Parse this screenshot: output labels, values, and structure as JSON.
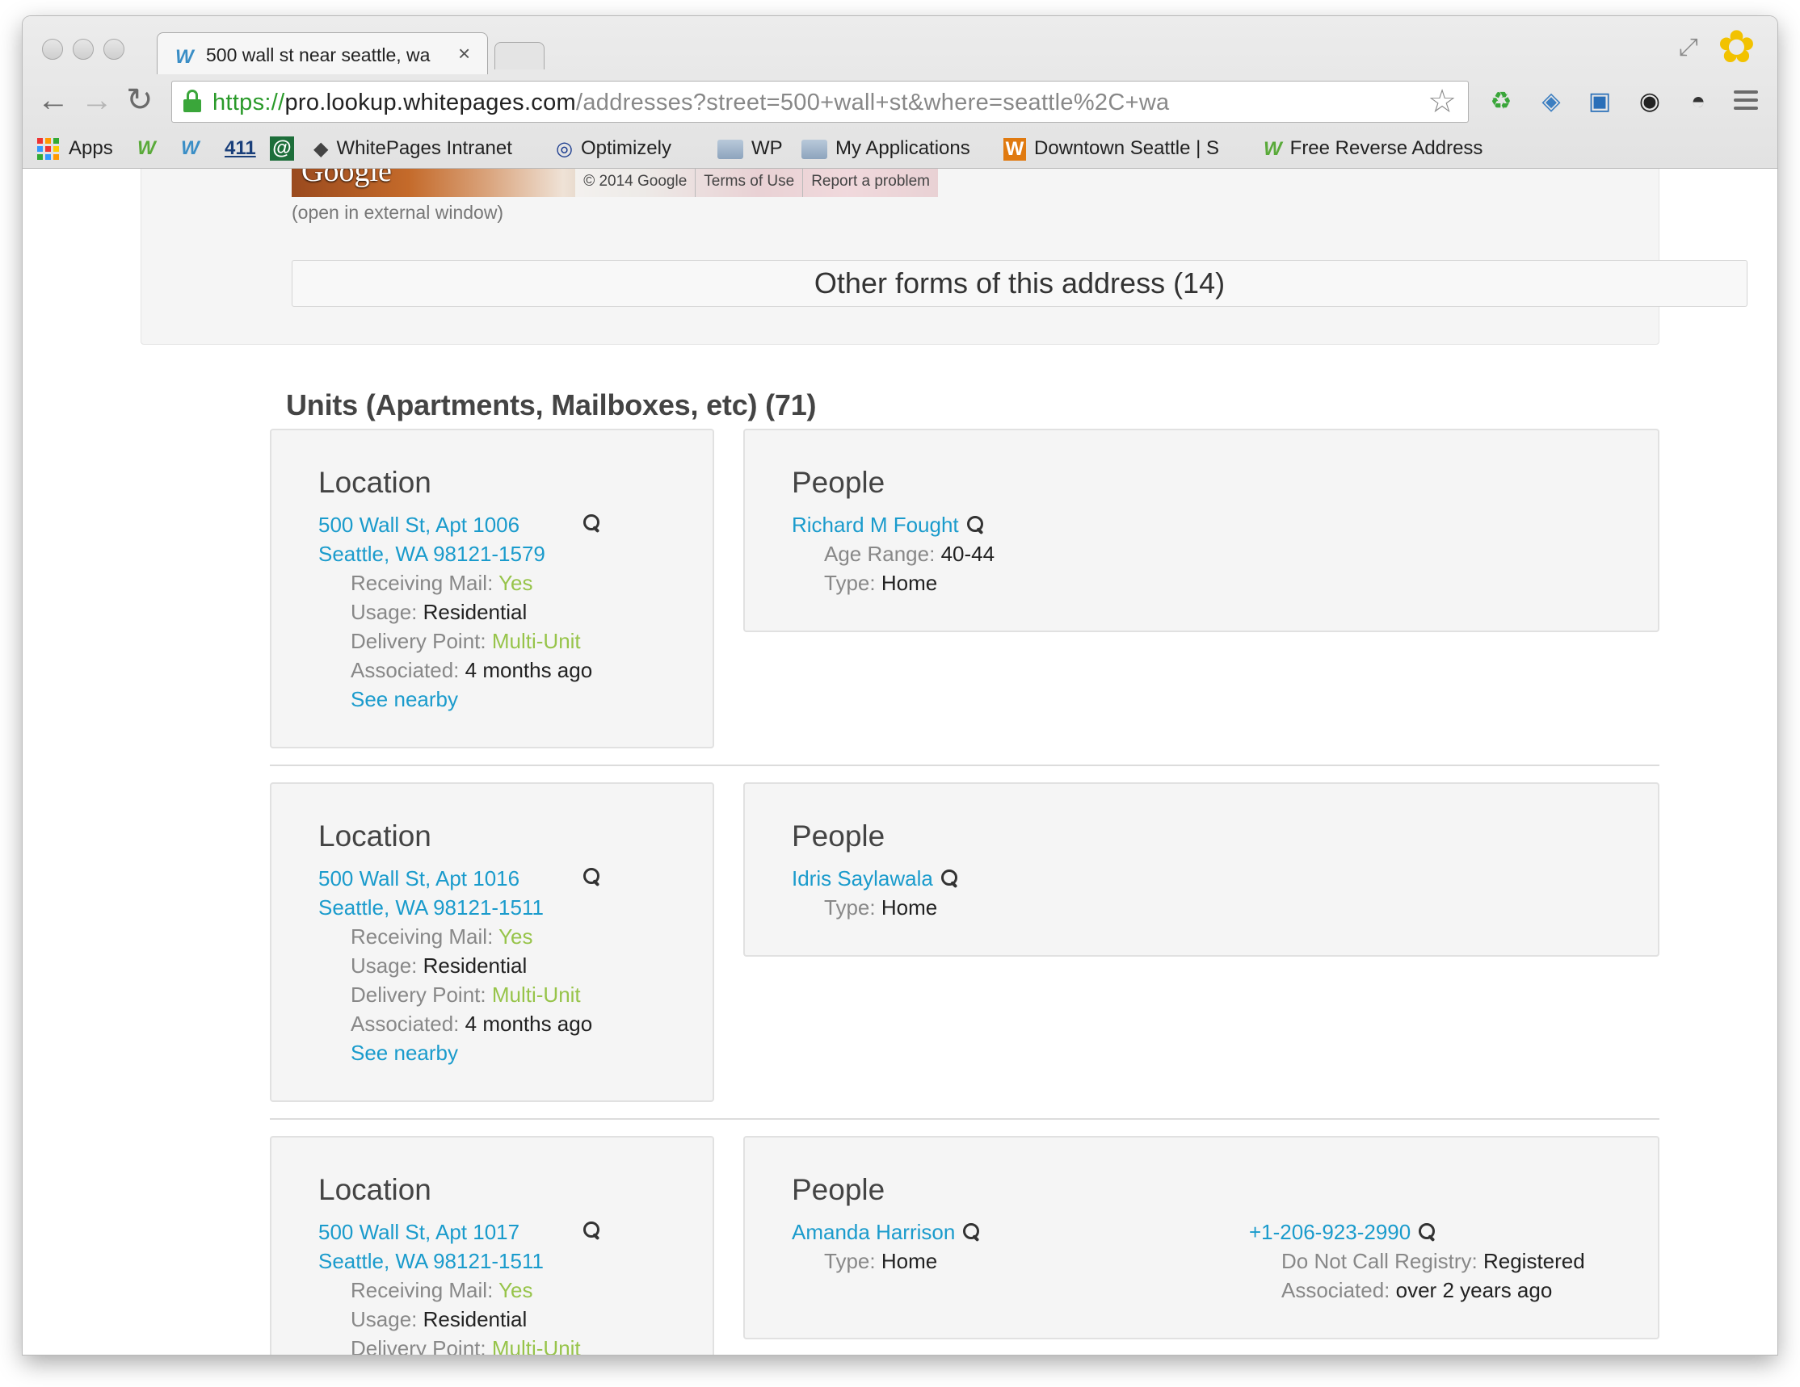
{
  "browser": {
    "tab_title": "500 wall st near seattle, wa",
    "url_scheme": "https://",
    "url_host": "pro.lookup.whitepages.com",
    "url_path": "/addresses?street=500+wall+st&where=seattle%2C+wa",
    "bookmarks": [
      {
        "icon": "apps-grid-icon",
        "label": "Apps"
      },
      {
        "icon": "whitepages-icon",
        "label": ""
      },
      {
        "icon": "whitepages-icon",
        "label": ""
      },
      {
        "icon": "411-icon",
        "label": "411"
      },
      {
        "icon": "at-icon",
        "label": "@"
      },
      {
        "icon": "intranet-icon",
        "label": "WhitePages Intranet"
      },
      {
        "icon": "optimizely-icon",
        "label": "Optimizely"
      },
      {
        "icon": "folder-icon",
        "label": "WP"
      },
      {
        "icon": "folder-icon",
        "label": "My Applications"
      },
      {
        "icon": "downtown-icon",
        "label": "Downtown Seattle | S"
      },
      {
        "icon": "whitepages-icon",
        "label": "Free Reverse Address"
      }
    ]
  },
  "map": {
    "logo": "Google",
    "copyright": "© 2014 Google",
    "terms": "Terms of Use",
    "report": "Report a problem",
    "external": "(open in external window)"
  },
  "other_forms": "Other forms of this address (14)",
  "units_heading": "Units (Apartments, Mailboxes, etc) (71)",
  "units": [
    {
      "location_heading": "Location",
      "address_line1": "500 Wall St, Apt 1006",
      "address_line2": "Seattle, WA 98121-1579",
      "receiving_mail_label": "Receiving Mail:",
      "receiving_mail": "Yes",
      "usage_label": "Usage:",
      "usage": "Residential",
      "delivery_label": "Delivery Point:",
      "delivery": "Multi-Unit",
      "associated_label": "Associated:",
      "associated": "4 months ago",
      "see_nearby": "See nearby",
      "people_heading": "People",
      "person_name": "Richard M Fought",
      "age_label": "Age Range:",
      "age": "40-44",
      "type_label": "Type:",
      "type": "Home"
    },
    {
      "location_heading": "Location",
      "address_line1": "500 Wall St, Apt 1016",
      "address_line2": "Seattle, WA 98121-1511",
      "receiving_mail_label": "Receiving Mail:",
      "receiving_mail": "Yes",
      "usage_label": "Usage:",
      "usage": "Residential",
      "delivery_label": "Delivery Point:",
      "delivery": "Multi-Unit",
      "associated_label": "Associated:",
      "associated": "4 months ago",
      "see_nearby": "See nearby",
      "people_heading": "People",
      "person_name": "Idris Saylawala",
      "type_label": "Type:",
      "type": "Home"
    },
    {
      "location_heading": "Location",
      "address_line1": "500 Wall St, Apt 1017",
      "address_line2": "Seattle, WA 98121-1511",
      "receiving_mail_label": "Receiving Mail:",
      "receiving_mail": "Yes",
      "usage_label": "Usage:",
      "usage": "Residential",
      "delivery_label": "Delivery Point:",
      "delivery": "Multi-Unit",
      "people_heading": "People",
      "person_name": "Amanda Harrison",
      "type_label": "Type:",
      "type": "Home",
      "phone": "+1-206-923-2990",
      "dnc_label": "Do Not Call Registry:",
      "dnc": "Registered",
      "phone_associated_label": "Associated:",
      "phone_associated": "over 2 years ago"
    }
  ],
  "colors": {
    "link": "#1a9bcc",
    "green_value": "#97c44a",
    "label": "#888888",
    "card_bg": "#f5f5f5"
  }
}
